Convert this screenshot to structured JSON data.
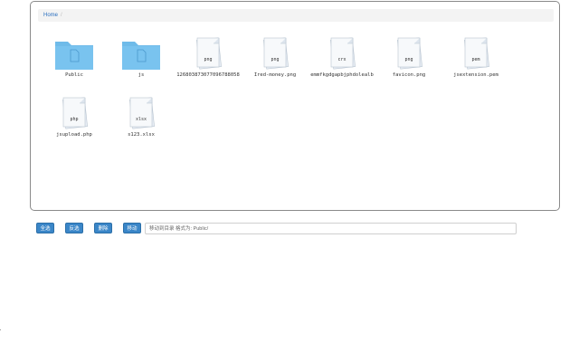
{
  "breadcrumb": {
    "home": "Home",
    "separator": "/"
  },
  "files": [
    {
      "name": "Public",
      "type": "folder",
      "badge": ""
    },
    {
      "name": "js",
      "type": "folder",
      "badge": ""
    },
    {
      "name": "126803873077096788058",
      "type": "file",
      "badge": "png"
    },
    {
      "name": "Ired-money.png",
      "type": "file",
      "badge": "png"
    },
    {
      "name": "emmfkgdgapbjphdolealb",
      "type": "file",
      "badge": "crx"
    },
    {
      "name": "favicon.png",
      "type": "file",
      "badge": "png"
    },
    {
      "name": "jsextension.pem",
      "type": "file",
      "badge": "pem"
    },
    {
      "name": "jsupload.php",
      "type": "file",
      "badge": "php"
    },
    {
      "name": "s123.xlsx",
      "type": "file",
      "badge": "xlsx"
    }
  ],
  "toolbar": {
    "select_all": "全选",
    "invert": "反选",
    "delete": "删除",
    "move": "移动"
  },
  "move_input": {
    "placeholder": "移动到目录 格式为: Public/",
    "value": ""
  },
  "icons": {
    "folder": "folder-icon",
    "file": "file-icon"
  },
  "colors": {
    "folder": "#79c3ef",
    "button": "#3a86c8",
    "link": "#2a6fbf"
  }
}
